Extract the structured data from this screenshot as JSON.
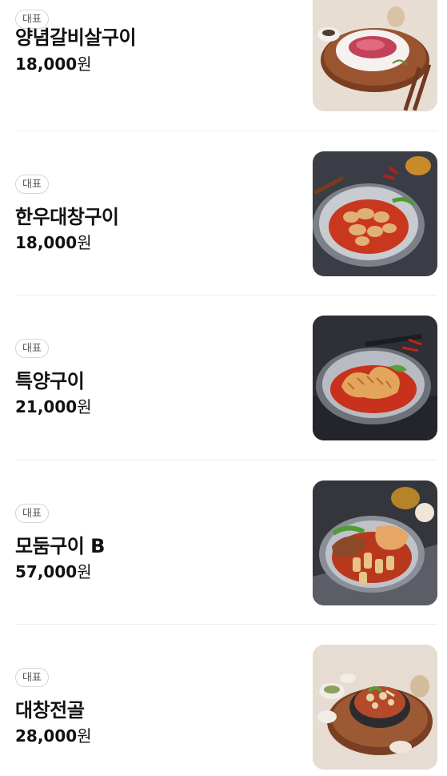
{
  "menu": {
    "items": [
      {
        "badge": "대표",
        "name": "양념갈비살구이",
        "price_number": "18,000",
        "price_unit": "원",
        "photo": "marinated-rib-dish-photo"
      },
      {
        "badge": "대표",
        "name": "한우대창구이",
        "price_number": "18,000",
        "price_unit": "원",
        "photo": "grilled-intestine-dish-photo"
      },
      {
        "badge": "대표",
        "name": "특양구이",
        "price_number": "21,000",
        "price_unit": "원",
        "photo": "grilled-tripe-dish-photo"
      },
      {
        "badge": "대표",
        "name": "모둠구이 B",
        "price_number": "57,000",
        "price_unit": "원",
        "photo": "assorted-grill-dish-photo"
      },
      {
        "badge": "대표",
        "name": "대창전골",
        "price_number": "28,000",
        "price_unit": "원",
        "photo": "intestine-hotpot-dish-photo"
      }
    ]
  }
}
